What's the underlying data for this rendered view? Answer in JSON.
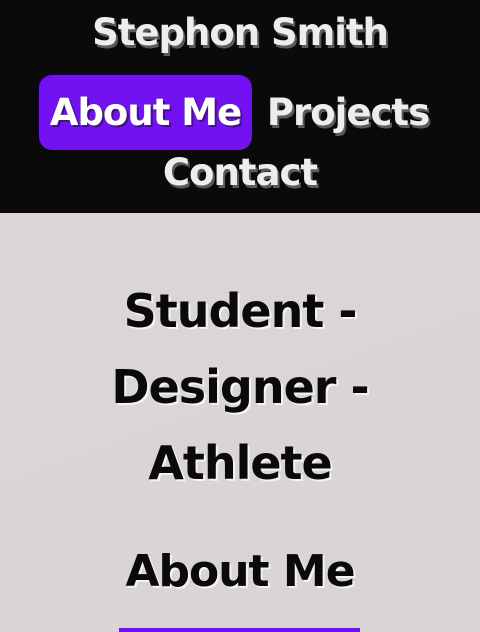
{
  "header": {
    "site_name": "Stephon Smith",
    "nav": {
      "about": "About Me",
      "projects": "Projects",
      "contact": "Contact"
    }
  },
  "main": {
    "tagline": [
      "Student -",
      "Designer -",
      "Athlete"
    ],
    "section_title": "About Me"
  },
  "colors": {
    "header_bg": "#0b0a0b",
    "accent": "#7211f2",
    "page_bg": "#dcd6d7"
  }
}
